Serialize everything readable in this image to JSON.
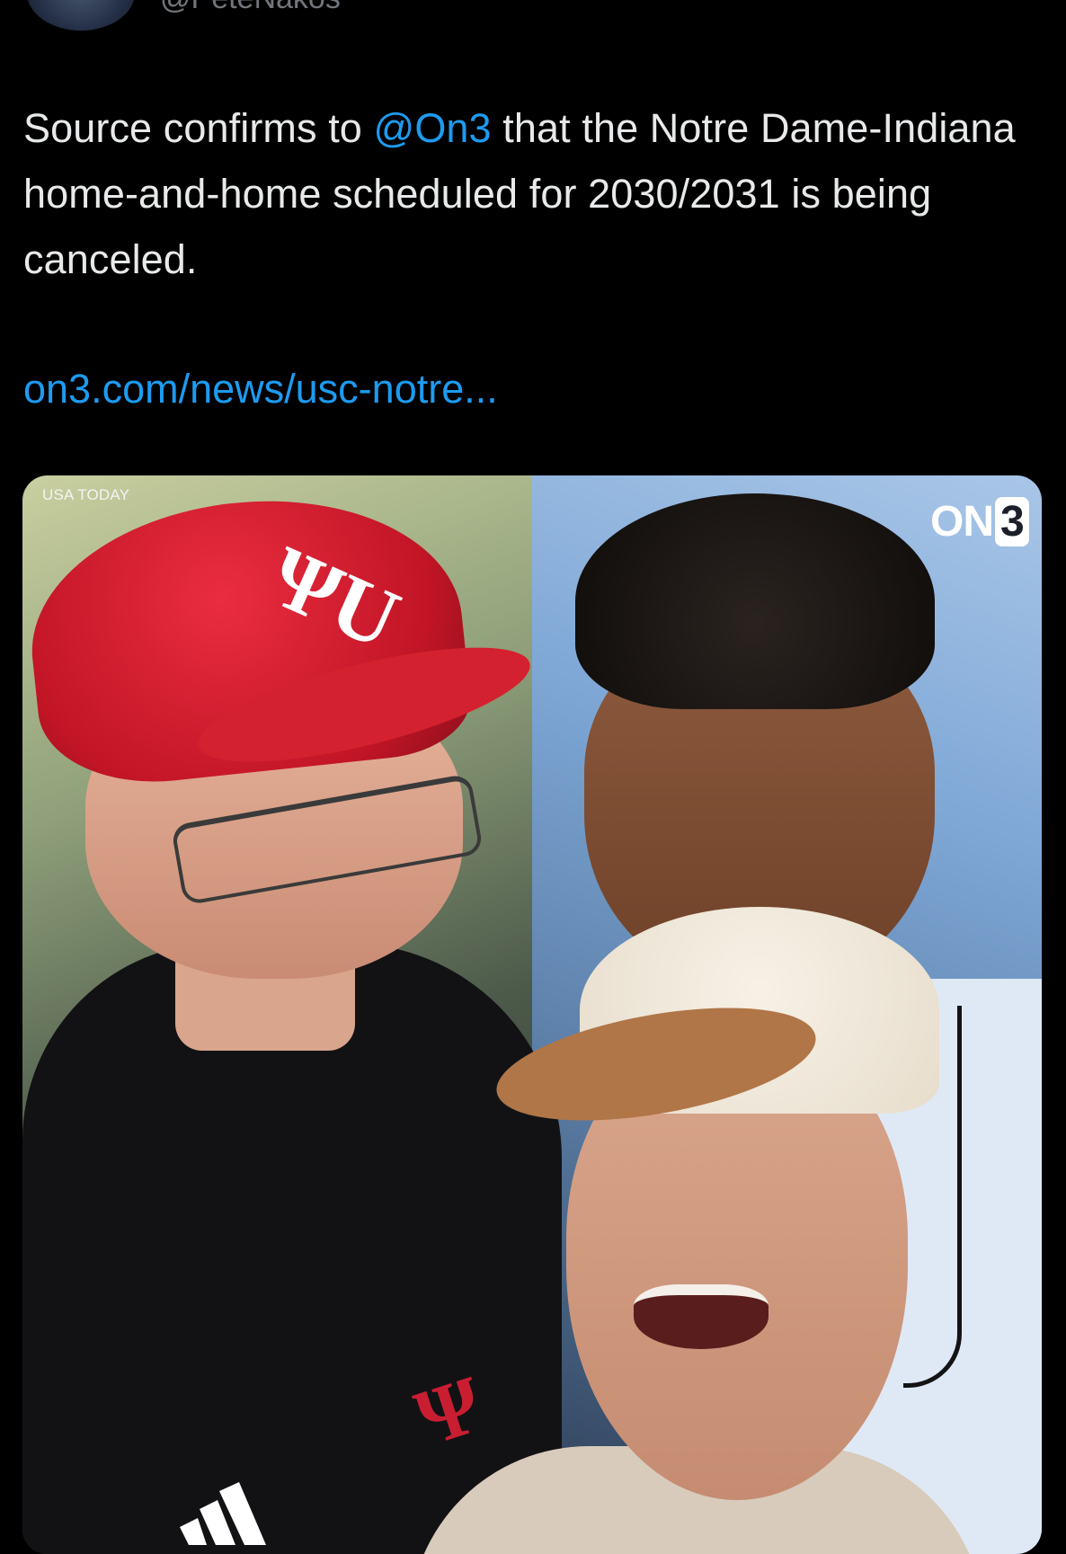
{
  "author": {
    "handle": "@PeteNakos",
    "avatar_icon": "avatar"
  },
  "tweet": {
    "text_before": "Source confirms to ",
    "mention": "@On3",
    "text_after": " that the Notre Dame-Indiana home-and-home scheduled for 2030/2031 is being canceled.",
    "link": "on3.com/news/usc-notre..."
  },
  "media": {
    "credit": "USA TODAY",
    "brand_prefix": "ON",
    "brand_box": "3"
  },
  "colors": {
    "background": "#000000",
    "text": "#e7e9ea",
    "accent": "#1d9bf0",
    "muted": "#71767b"
  }
}
